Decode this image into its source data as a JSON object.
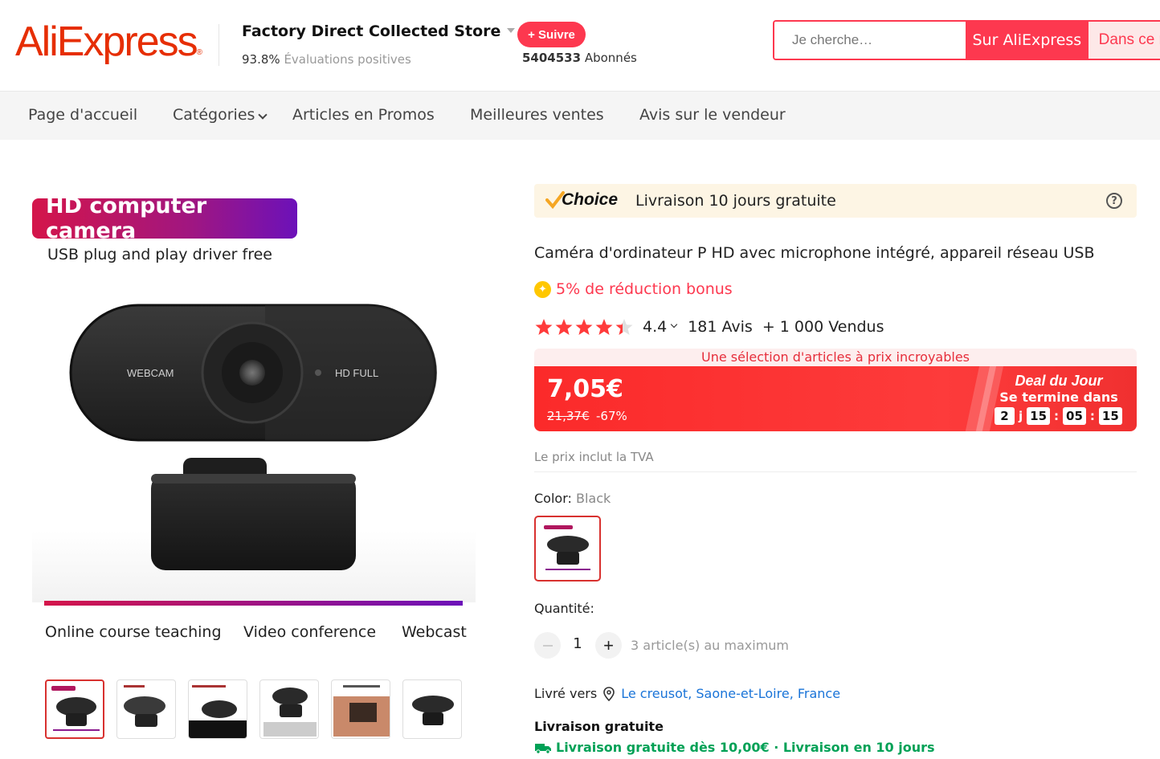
{
  "header": {
    "logo_text": "AliExpress",
    "store_name": "Factory Direct Collected Store",
    "positive_pct": "93.8%",
    "positive_label": "Évaluations positives",
    "follow_label": "+ Suivre",
    "followers_count": "5404533",
    "followers_label": "Abonnés",
    "search_placeholder": "Je cherche…",
    "search_aliexpress": "Sur AliExpress",
    "search_store": "Dans ce magasin"
  },
  "nav": {
    "items": [
      "Page d'accueil",
      "Catégories",
      "Articles en Promos",
      "Meilleures ventes",
      "Avis sur le vendeur"
    ]
  },
  "image": {
    "promo_title": "HD computer camera",
    "promo_sub": "USB plug and play driver free",
    "cam_label_left": "WEBCAM",
    "cam_label_right": "HD FULL",
    "features": [
      "Online course teaching",
      "Video conference",
      "Webcast"
    ],
    "thumbnail_count": 6,
    "active_thumbnail": 1
  },
  "choice": {
    "label": "Choice",
    "text": "Livraison 10 jours gratuite"
  },
  "product": {
    "title": "Caméra d'ordinateur P HD avec microphone intégré, appareil réseau USB",
    "bonus": "5% de réduction bonus",
    "rating": "4.4",
    "rating_stars": 4.4,
    "reviews": "181 Avis",
    "sold": "+ 1 000 Vendus"
  },
  "price": {
    "banner": "Une sélection d'articles à prix incroyables",
    "current": "7,05€",
    "original": "21,37€",
    "discount": "-67%",
    "deal_title": "Deal du Jour",
    "deal_sub": "Se termine dans",
    "timer_days": "2",
    "timer_day_unit": "j",
    "timer_hours": "15",
    "timer_minutes": "05",
    "timer_seconds": "15",
    "vat_note": "Le prix inclut la TVA"
  },
  "options": {
    "color_label": "Color:",
    "color_value": "Black",
    "quantity_label": "Quantité:",
    "quantity_value": "1",
    "quantity_max": "3 article(s) au maximum"
  },
  "shipping": {
    "ship_to_label": "Livré vers",
    "ship_to_location": "Le creusot, Saone-et-Loire, France",
    "free_title": "Livraison gratuite",
    "free_detail": "Livraison gratuite dès 10,00€ · Livraison en 10 jours"
  },
  "colors": {
    "brand": "#e62e04",
    "accent": "#fd384f",
    "link": "#1a74d8",
    "shipping_green": "#00a156",
    "star": "#ff3b3b"
  }
}
